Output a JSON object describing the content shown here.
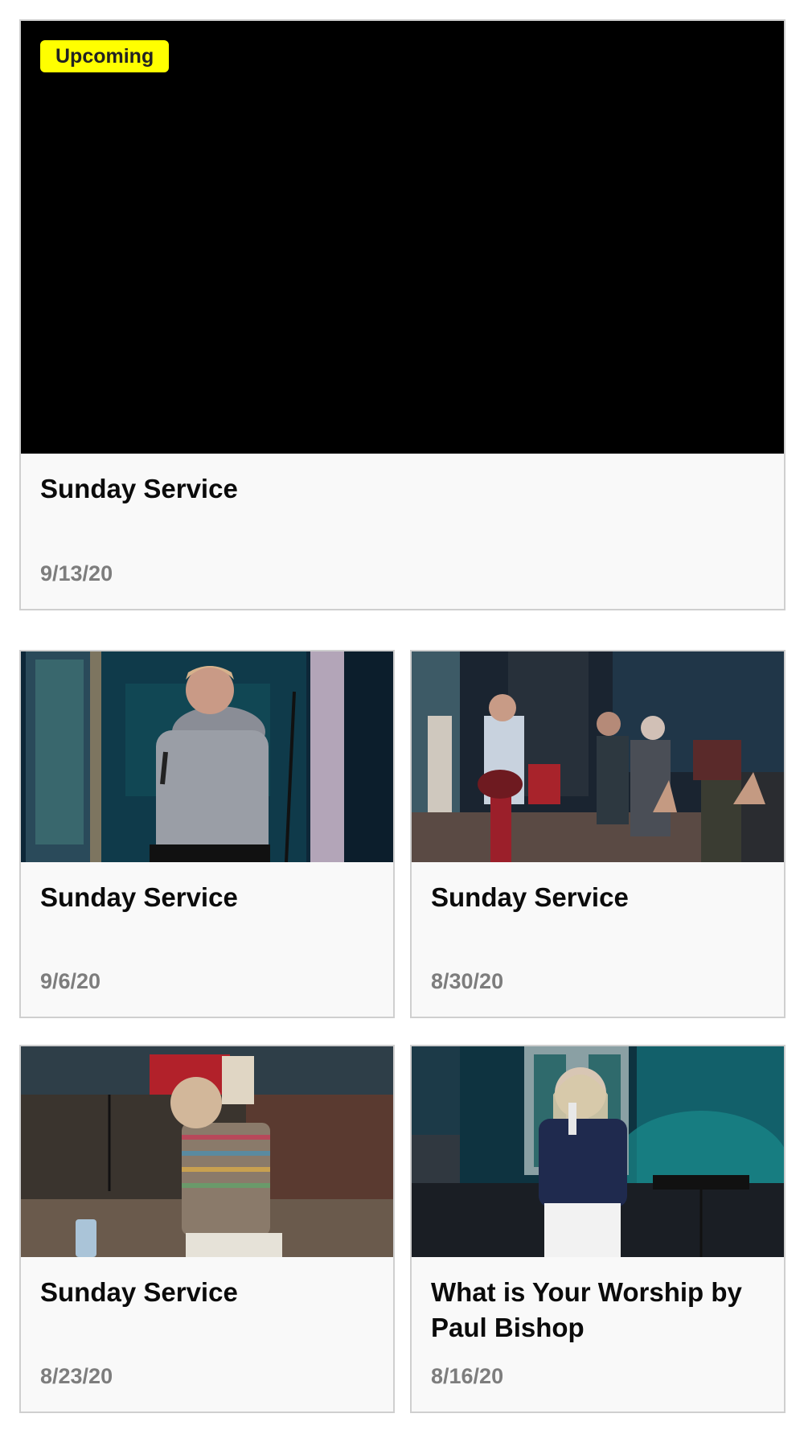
{
  "featured": {
    "badge": "Upcoming",
    "title": "Sunday Service",
    "date": "9/13/20"
  },
  "videos": [
    {
      "title": "Sunday Service",
      "date": "9/6/20"
    },
    {
      "title": "Sunday Service",
      "date": "8/30/20"
    },
    {
      "title": "Sunday Service",
      "date": "8/23/20"
    },
    {
      "title": "What is Your Worship by Paul Bishop",
      "date": "8/16/20"
    }
  ],
  "colors": {
    "badge_bg": "#ffff00",
    "card_bg": "#f9f9f9",
    "card_border": "#cfcfcf",
    "date_text": "#7d7d7d",
    "stage_teal": "#0e5560"
  }
}
